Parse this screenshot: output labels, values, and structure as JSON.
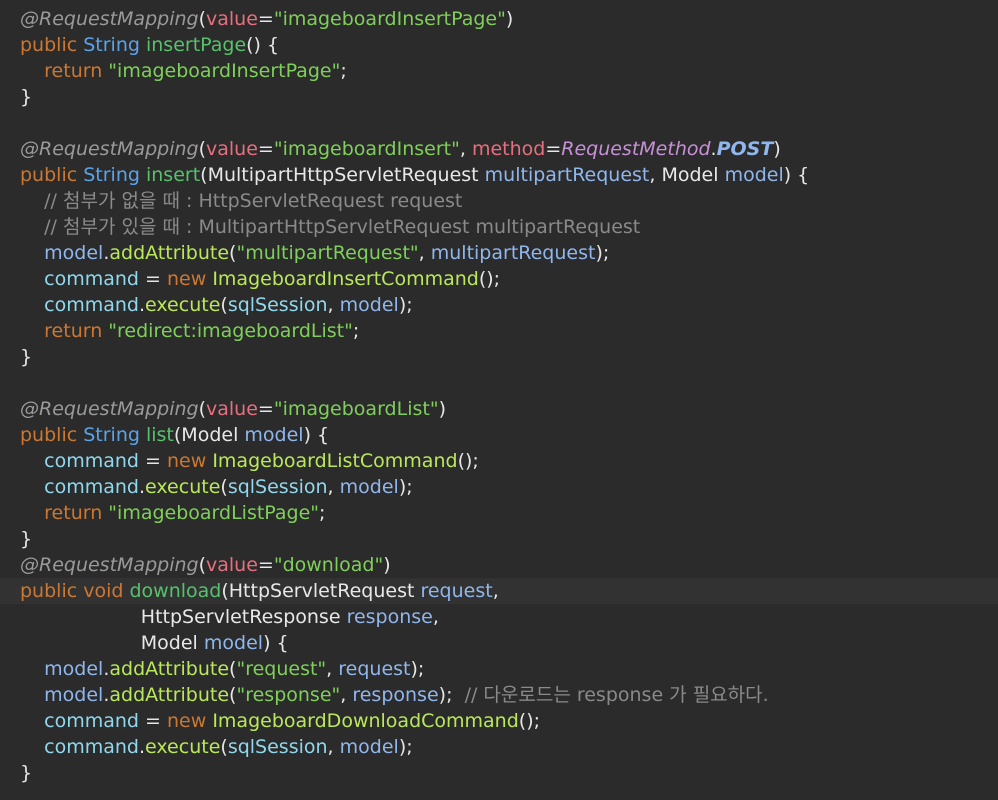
{
  "editor": {
    "lines": [
      {
        "t": [
          [
            "@RequestMapping",
            "ann"
          ],
          [
            "(",
            "plain"
          ],
          [
            "value",
            "attr"
          ],
          [
            "=",
            "plain"
          ],
          [
            "\"imageboardInsertPage\"",
            "str"
          ],
          [
            ")",
            "plain"
          ]
        ]
      },
      {
        "t": [
          [
            "public ",
            "kw"
          ],
          [
            "String ",
            "type"
          ],
          [
            "insertPage",
            "fn"
          ],
          [
            "() {",
            "plain"
          ]
        ]
      },
      {
        "t": [
          [
            "    return ",
            "kw"
          ],
          [
            "\"imageboardInsertPage\"",
            "str"
          ],
          [
            ";",
            "plain"
          ]
        ]
      },
      {
        "t": [
          [
            "}",
            "plain"
          ]
        ]
      },
      {
        "t": []
      },
      {
        "t": [
          [
            "@RequestMapping",
            "ann"
          ],
          [
            "(",
            "plain"
          ],
          [
            "value",
            "attr"
          ],
          [
            "=",
            "plain"
          ],
          [
            "\"imageboardInsert\"",
            "str"
          ],
          [
            ", ",
            "plain"
          ],
          [
            "method",
            "attr"
          ],
          [
            "=",
            "plain"
          ],
          [
            "RequestMethod",
            "enumc"
          ],
          [
            ".",
            "plain"
          ],
          [
            "POST",
            "enumv"
          ],
          [
            ")",
            "plain"
          ]
        ]
      },
      {
        "t": [
          [
            "public ",
            "kw"
          ],
          [
            "String ",
            "type"
          ],
          [
            "insert",
            "fn"
          ],
          [
            "(",
            "plain"
          ],
          [
            "MultipartHttpServletRequest ",
            "cls"
          ],
          [
            "multipartRequest",
            "param"
          ],
          [
            ", ",
            "plain"
          ],
          [
            "Model ",
            "cls"
          ],
          [
            "model",
            "param"
          ],
          [
            ") {",
            "plain"
          ]
        ]
      },
      {
        "t": [
          [
            "    // 첨부가 없을 때 : HttpServletRequest request",
            "com"
          ]
        ]
      },
      {
        "t": [
          [
            "    // 첨부가 있을 때 : MultipartHttpServletRequest multipartRequest",
            "com"
          ]
        ]
      },
      {
        "t": [
          [
            "    model",
            "param"
          ],
          [
            ".",
            "plain"
          ],
          [
            "addAttribute",
            "method"
          ],
          [
            "(",
            "plain"
          ],
          [
            "\"multipartRequest\"",
            "str"
          ],
          [
            ", ",
            "plain"
          ],
          [
            "multipartRequest",
            "param"
          ],
          [
            ");",
            "plain"
          ]
        ]
      },
      {
        "t": [
          [
            "    command",
            "field"
          ],
          [
            " = ",
            "plain"
          ],
          [
            "new ",
            "kw"
          ],
          [
            "ImageboardInsertCommand",
            "method"
          ],
          [
            "();",
            "plain"
          ]
        ]
      },
      {
        "t": [
          [
            "    command",
            "field"
          ],
          [
            ".",
            "plain"
          ],
          [
            "execute",
            "method"
          ],
          [
            "(",
            "plain"
          ],
          [
            "sqlSession",
            "field"
          ],
          [
            ", ",
            "plain"
          ],
          [
            "model",
            "param"
          ],
          [
            ");",
            "plain"
          ]
        ]
      },
      {
        "t": [
          [
            "    return ",
            "kw"
          ],
          [
            "\"redirect:imageboardList\"",
            "str"
          ],
          [
            ";",
            "plain"
          ]
        ]
      },
      {
        "t": [
          [
            "}",
            "plain"
          ]
        ]
      },
      {
        "t": []
      },
      {
        "t": [
          [
            "@RequestMapping",
            "ann"
          ],
          [
            "(",
            "plain"
          ],
          [
            "value",
            "attr"
          ],
          [
            "=",
            "plain"
          ],
          [
            "\"imageboardList\"",
            "str"
          ],
          [
            ")",
            "plain"
          ]
        ]
      },
      {
        "t": [
          [
            "public ",
            "kw"
          ],
          [
            "String ",
            "type"
          ],
          [
            "list",
            "fn"
          ],
          [
            "(",
            "plain"
          ],
          [
            "Model ",
            "cls"
          ],
          [
            "model",
            "param"
          ],
          [
            ") {",
            "plain"
          ]
        ]
      },
      {
        "t": [
          [
            "    command",
            "field"
          ],
          [
            " = ",
            "plain"
          ],
          [
            "new ",
            "kw"
          ],
          [
            "ImageboardListCommand",
            "method"
          ],
          [
            "();",
            "plain"
          ]
        ]
      },
      {
        "t": [
          [
            "    command",
            "field"
          ],
          [
            ".",
            "plain"
          ],
          [
            "execute",
            "method"
          ],
          [
            "(",
            "plain"
          ],
          [
            "sqlSession",
            "field"
          ],
          [
            ", ",
            "plain"
          ],
          [
            "model",
            "param"
          ],
          [
            ");",
            "plain"
          ]
        ]
      },
      {
        "t": [
          [
            "    return ",
            "kw"
          ],
          [
            "\"imageboardListPage\"",
            "str"
          ],
          [
            ";",
            "plain"
          ]
        ]
      },
      {
        "t": [
          [
            "}",
            "plain"
          ]
        ]
      },
      {
        "t": [
          [
            "@RequestMapping",
            "ann"
          ],
          [
            "(",
            "plain"
          ],
          [
            "value",
            "attr"
          ],
          [
            "=",
            "plain"
          ],
          [
            "\"download\"",
            "str"
          ],
          [
            ")",
            "plain"
          ]
        ]
      },
      {
        "t": [
          [
            "public ",
            "kw"
          ],
          [
            "void ",
            "kw"
          ],
          [
            "download",
            "fn"
          ],
          [
            "(",
            "plain"
          ],
          [
            "HttpServletRequest ",
            "cls"
          ],
          [
            "request",
            "param"
          ],
          [
            ",",
            "plain"
          ]
        ],
        "highlight": true
      },
      {
        "t": [
          [
            "                    HttpServletResponse ",
            "cls"
          ],
          [
            "response",
            "param"
          ],
          [
            ",",
            "plain"
          ]
        ]
      },
      {
        "t": [
          [
            "                    Model ",
            "cls"
          ],
          [
            "model",
            "param"
          ],
          [
            ") {",
            "plain"
          ]
        ]
      },
      {
        "t": [
          [
            "    model",
            "param"
          ],
          [
            ".",
            "plain"
          ],
          [
            "addAttribute",
            "method"
          ],
          [
            "(",
            "plain"
          ],
          [
            "\"request\"",
            "str"
          ],
          [
            ", ",
            "plain"
          ],
          [
            "request",
            "param"
          ],
          [
            ");",
            "plain"
          ]
        ]
      },
      {
        "t": [
          [
            "    model",
            "param"
          ],
          [
            ".",
            "plain"
          ],
          [
            "addAttribute",
            "method"
          ],
          [
            "(",
            "plain"
          ],
          [
            "\"response\"",
            "str"
          ],
          [
            ", ",
            "plain"
          ],
          [
            "response",
            "param"
          ],
          [
            ");  ",
            "plain"
          ],
          [
            "// 다운로드는 response 가 필요하다.",
            "com"
          ]
        ]
      },
      {
        "t": [
          [
            "    command",
            "field"
          ],
          [
            " = ",
            "plain"
          ],
          [
            "new ",
            "kw"
          ],
          [
            "ImageboardDownloadCommand",
            "method"
          ],
          [
            "();",
            "plain"
          ]
        ]
      },
      {
        "t": [
          [
            "    command",
            "field"
          ],
          [
            ".",
            "plain"
          ],
          [
            "execute",
            "method"
          ],
          [
            "(",
            "plain"
          ],
          [
            "sqlSession",
            "field"
          ],
          [
            ", ",
            "plain"
          ],
          [
            "model",
            "param"
          ],
          [
            ");",
            "plain"
          ]
        ]
      },
      {
        "t": [
          [
            "}",
            "plain"
          ]
        ]
      }
    ]
  }
}
